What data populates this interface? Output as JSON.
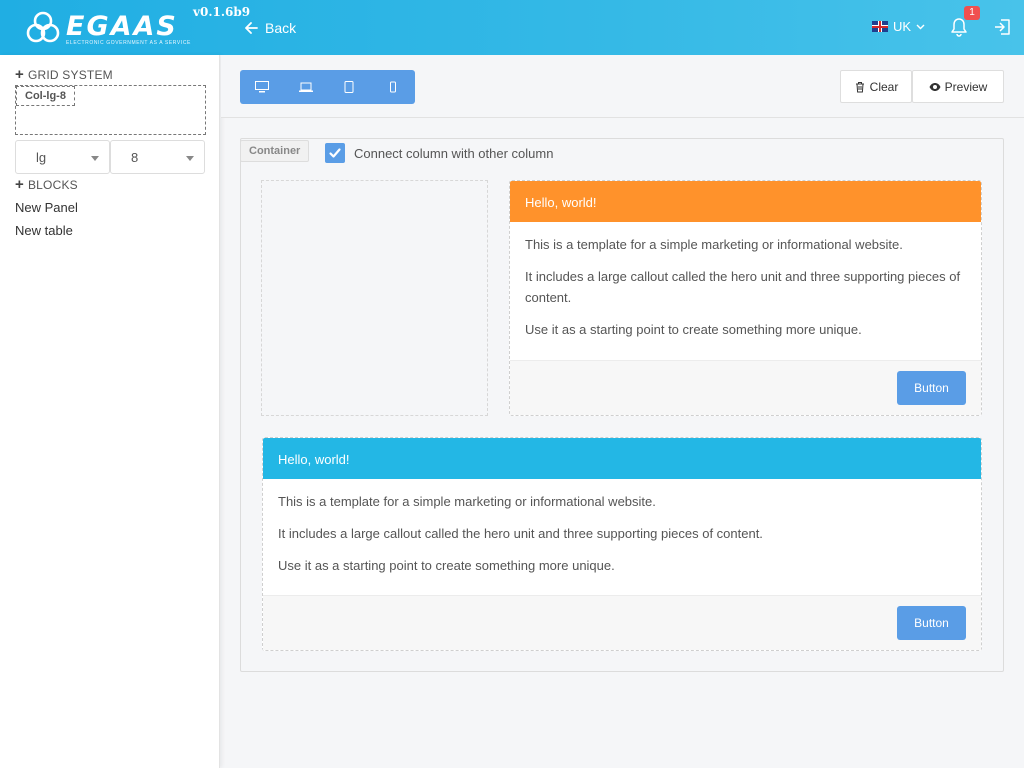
{
  "app": {
    "logo_text": "EGAAS",
    "logo_tagline": "ELECTRONIC GOVERNMENT AS A SERVICE",
    "version": "v0.1.6b9",
    "back_label": "Back",
    "language": "UK",
    "notifications_count": "1",
    "header_gradient": [
      "#20aee3",
      "#48c3ea"
    ]
  },
  "sidebar": {
    "grid_system_label": "GRID SYSTEM",
    "grid_chip": "Col-lg-8",
    "size_select": "lg",
    "cols_select": "8",
    "blocks_label": "BLOCKS",
    "blocks": [
      "New Panel",
      "New table"
    ]
  },
  "toolbar": {
    "devices": [
      "desktop-icon",
      "laptop-icon",
      "tablet-icon",
      "phone-icon"
    ],
    "clear_label": "Clear",
    "preview_label": "Preview",
    "accent": "#5a9de6"
  },
  "canvas": {
    "container_tag": "Container",
    "connect_label": "Connect column with other column",
    "connect_checked": true,
    "panels": [
      {
        "title": "Hello, world!",
        "color": "#ff922b",
        "lines": [
          "This is a template for a simple marketing or informational website.",
          "It includes a large callout called the hero unit and three supporting pieces of content.",
          "Use it as a starting point to create something more unique."
        ],
        "button": "Button"
      },
      {
        "title": "Hello, world!",
        "color": "#23b7e5",
        "lines": [
          "This is a template for a simple marketing or informational website.",
          "It includes a large callout called the hero unit and three supporting pieces of content.",
          "Use it as a starting point to create something more unique."
        ],
        "button": "Button"
      }
    ]
  }
}
